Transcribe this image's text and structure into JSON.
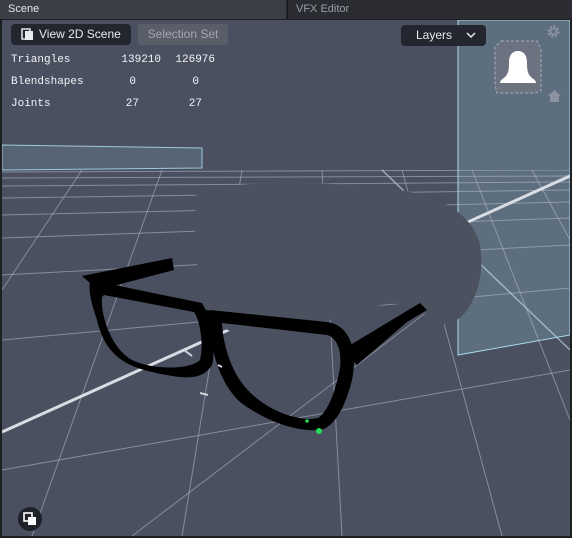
{
  "tabs": [
    {
      "label": "Scene",
      "active": true
    },
    {
      "label": "VFX Editor",
      "active": false
    }
  ],
  "toolbar": {
    "view_2d_label": "View 2D Scene",
    "selection_set_label": "Selection Set",
    "layers_label": "Layers"
  },
  "stats": {
    "rows": [
      {
        "label": "Triangles",
        "a": "139210",
        "b": "126976"
      },
      {
        "label": "Blendshapes",
        "a": "0",
        "b": "0"
      },
      {
        "label": "Joints",
        "a": "27",
        "b": "27"
      }
    ]
  },
  "icons": {
    "view_2d": "view-2d-icon",
    "layers_dropdown": "chevron-down-icon",
    "settings": "gear-icon",
    "orientation": "navigation-cube-icon",
    "home": "home-icon",
    "corner": "overlap-squares-icon"
  },
  "colors": {
    "viewport_background": "#4a5060",
    "grid_line": "#b8bec8",
    "glasses": "#000000",
    "selection_handle": "#22dd55",
    "tab_active": "#3b3e46"
  }
}
